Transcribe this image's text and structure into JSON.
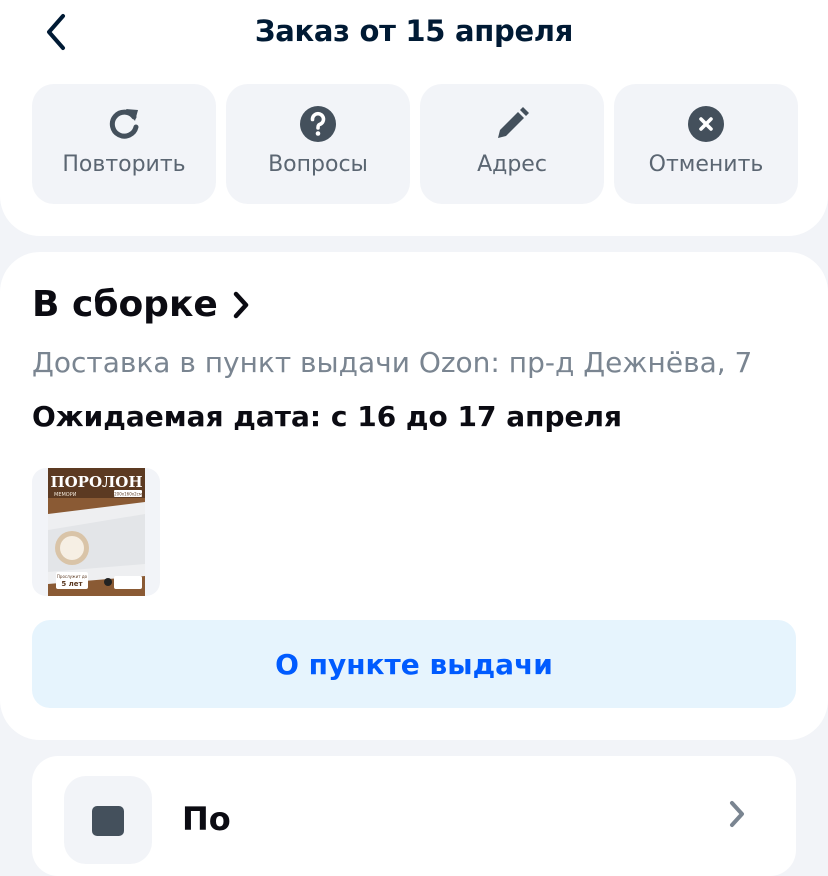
{
  "header": {
    "title": "Заказ от 15 апреля",
    "back_icon": "chevron-left-icon"
  },
  "actions": [
    {
      "label": "Повторить",
      "icon": "repeat-icon"
    },
    {
      "label": "Вопросы",
      "icon": "question-icon"
    },
    {
      "label": "Адрес",
      "icon": "pencil-icon"
    },
    {
      "label": "Отменить",
      "icon": "cancel-icon"
    }
  ],
  "order": {
    "status": "В сборке",
    "status_icon": "chevron-right-icon",
    "delivery": "Доставка в пункт выдачи Ozon: пр-д Дежнёва, 7",
    "expected": "Ожидаемая дата: с 16 до 17 апреля",
    "product": {
      "title": "ПОРОЛОН",
      "subtitle": "МЕМОРИ",
      "size": "200x160x2см",
      "warranty_label": "Прослужит до",
      "warranty_value": "5 лет"
    },
    "pickup_button": "О пункте выдачи"
  },
  "bottom": {
    "text": "По",
    "icon": "document-icon"
  },
  "colors": {
    "background": "#f2f4f8",
    "title": "#001a34",
    "icon": "#44505c",
    "secondary": "#7a8591",
    "accent": "#005bff",
    "button_bg": "#e6f4fd"
  }
}
